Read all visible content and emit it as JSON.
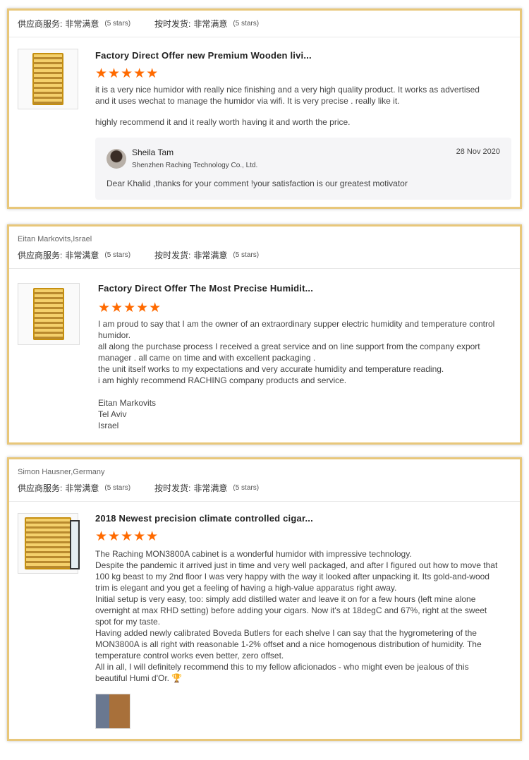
{
  "labels": {
    "supplier_service": "供应商服务:",
    "on_time_shipping": "按时发货:",
    "rating_value": "非常满意",
    "stars_text": "(5 stars)"
  },
  "reviews": [
    {
      "author": "",
      "product_title": "Factory Direct Offer new Premium Wooden livi...",
      "rating": 5,
      "paragraphs": [
        "it is a very nice humidor with really nice finishing and a very high quality product. It works as advertised and it uses wechat to manage the humidor via wifi. It is very precise . really like it.",
        "highly recommend it and it really worth having it and worth the price."
      ],
      "reply": {
        "name": "Sheila Tam",
        "company": "Shenzhen Raching Technology Co., Ltd.",
        "date": "28 Nov 2020",
        "text": "Dear Khalid ,thanks for your comment !your satisfaction is our greatest motivator"
      }
    },
    {
      "author": "Eitan Markovits,Israel",
      "product_title": "Factory Direct Offer The Most Precise Humidit...",
      "rating": 5,
      "lines": [
        "I am proud to say that I am the owner of an extraordinary supper electric humidity and temperature control humidor.",
        "all along the purchase process I received a great service and on line support from the company export manager . all came on time and with excellent packaging .",
        "the unit itself works to my expectations and very accurate humidity and temperature reading.",
        "i am highly recommend RACHING company products and service."
      ],
      "signature": [
        "Eitan Markovits",
        "Tel Aviv",
        "Israel"
      ]
    },
    {
      "author": "Simon Hausner,Germany",
      "product_title": "2018 Newest precision climate controlled cigar...",
      "rating": 5,
      "lines": [
        "The Raching MON3800A cabinet is a wonderful humidor with impressive technology.",
        "Despite the pandemic it arrived just in time and very well packaged, and after I figured out how to move that 100 kg beast to my 2nd floor I was very happy with the way it looked after unpacking it. Its gold-and-wood trim is elegant and you get a feeling of having a high-value apparatus right away.",
        "Initial setup is very easy, too: simply add distilled water and leave it on for a few hours (left mine alone overnight at max RHD setting) before adding your cigars. Now it's at 18degC and 67%, right at the sweet spot for my taste.",
        "Having added newly calibrated Boveda Butlers for each shelve I can say that the hygrometering of the MON3800A is all right with reasonable 1-2% offset and a nice homogenous distribution of humidity. The temperature control works even better, zero offset.",
        "All in all, I will definitely recommend this to my fellow aficionados - who might even be jealous of this beautiful Humi d'Or. 🏆"
      ]
    }
  ],
  "star_glyphs": "★★★★★",
  "colors": {
    "border": "#e8c77a",
    "star": "#ff6a00"
  }
}
